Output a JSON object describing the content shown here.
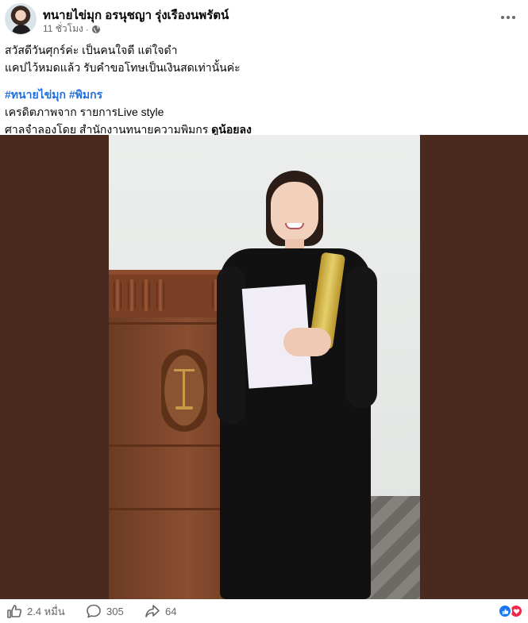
{
  "post": {
    "author": "ทนายไข่มุก อรนุชญา รุ่งเรืองนพรัตน์",
    "time": "11 ชั่วโมง",
    "separator": "·",
    "privacy_icon": "globe-icon",
    "more_icon": "more-options-icon",
    "lines": {
      "line1": "สวัสดีวันศุกร์ค่ะ เป็นคนใจดี แต่ใจดำ",
      "line2": "แคปไว้หมดแล้ว รับคำขอโทษเป็นเงินสดเท่านั้นค่ะ",
      "hashtag1": "#ทนายไข่มุก",
      "hashtag2": "#พิมกร",
      "credit": "เครดิตภาพจาก รายการLive style",
      "reenact_prefix": "ศาลจำลองโดย สำนักงานทนายความพิมกร ",
      "reenact_bold": "ดูน้อยลง"
    }
  },
  "actions": {
    "like_icon": "thumbs-up-icon",
    "like_count": "2.4 หมื่น",
    "comment_icon": "comment-icon",
    "comment_count": "305",
    "share_icon": "share-icon",
    "share_count": "64",
    "reaction_icons": [
      "like-reaction-icon",
      "love-reaction-icon"
    ]
  },
  "colors": {
    "hashtag": "#216fdb",
    "secondary_text": "#65676b",
    "like_blue": "#1877f2",
    "love_red": "#f0284a",
    "photo_frame": "#4a2a1e"
  }
}
